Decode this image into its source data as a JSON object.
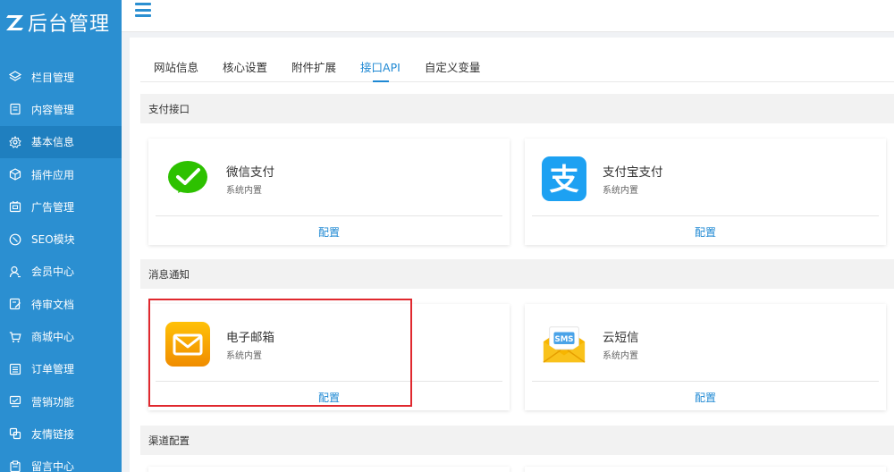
{
  "brand": {
    "title": "后台管理"
  },
  "sidebar": {
    "items": [
      {
        "label": "栏目管理",
        "icon": "layers-icon"
      },
      {
        "label": "内容管理",
        "icon": "document-icon"
      },
      {
        "label": "基本信息",
        "icon": "gear-icon",
        "active": true
      },
      {
        "label": "插件应用",
        "icon": "cube-icon"
      },
      {
        "label": "广告管理",
        "icon": "ad-icon"
      },
      {
        "label": "SEO模块",
        "icon": "seo-icon"
      },
      {
        "label": "会员中心",
        "icon": "user-icon"
      },
      {
        "label": "待审文档",
        "icon": "edit-doc-icon"
      },
      {
        "label": "商城中心",
        "icon": "cart-icon"
      },
      {
        "label": "订单管理",
        "icon": "list-icon"
      },
      {
        "label": "营销功能",
        "icon": "marketing-icon"
      },
      {
        "label": "友情链接",
        "icon": "link-icon"
      },
      {
        "label": "留言中心",
        "icon": "message-icon"
      }
    ]
  },
  "tabs": [
    {
      "label": "网站信息"
    },
    {
      "label": "核心设置"
    },
    {
      "label": "附件扩展"
    },
    {
      "label": "接口API",
      "active": true
    },
    {
      "label": "自定义变量"
    }
  ],
  "sections": {
    "payment": "支付接口",
    "notification": "消息通知",
    "channel": "渠道配置"
  },
  "cards": {
    "wechat": {
      "name": "微信支付",
      "sub": "系统内置",
      "action": "配置"
    },
    "alipay": {
      "name": "支付宝支付",
      "sub": "系统内置",
      "action": "配置"
    },
    "email": {
      "name": "电子邮箱",
      "sub": "系统内置",
      "action": "配置"
    },
    "sms": {
      "name": "云短信",
      "sub": "系统内置",
      "action": "配置",
      "badge": "SMS"
    }
  },
  "colors": {
    "sidebar": "#2b8fd1",
    "accent": "#1e88d3",
    "wechat": "#2dc100",
    "alipay": "#1da1f2",
    "email": "#f5a400",
    "highlight": "#e0282e"
  }
}
